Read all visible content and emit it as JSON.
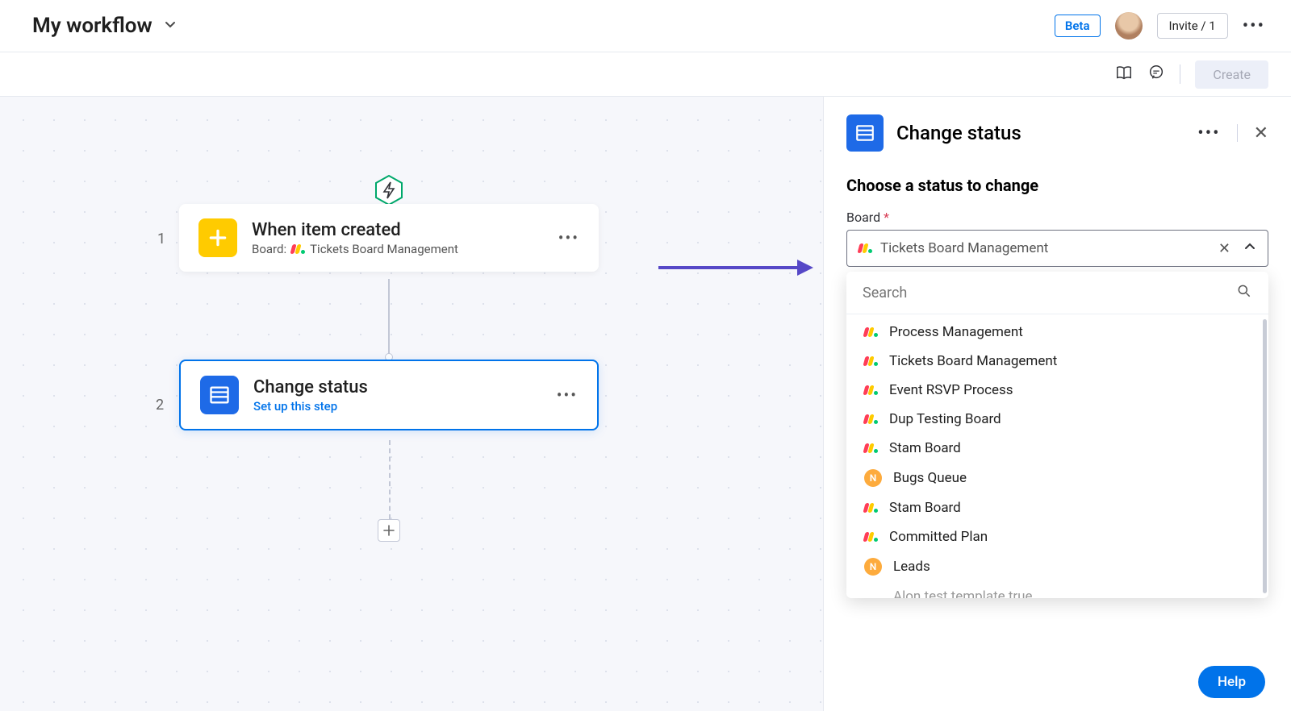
{
  "header": {
    "title": "My workflow",
    "beta_label": "Beta",
    "invite_label": "Invite / 1"
  },
  "subheader": {
    "create_label": "Create"
  },
  "canvas": {
    "steps": [
      {
        "num": "1",
        "title": "When item created",
        "sub_prefix": "Board:",
        "board": "Tickets Board Management"
      },
      {
        "num": "2",
        "title": "Change status",
        "sub_link": "Set up this step"
      }
    ]
  },
  "panel": {
    "title": "Change status",
    "section_title": "Choose a status to change",
    "board_label": "Board",
    "board_value": "Tickets Board Management",
    "search_placeholder": "Search",
    "options": [
      {
        "type": "board",
        "label": "Process Management"
      },
      {
        "type": "board",
        "label": "Tickets Board Management"
      },
      {
        "type": "board",
        "label": "Event RSVP Process"
      },
      {
        "type": "board",
        "label": "Dup Testing Board"
      },
      {
        "type": "board",
        "label": "Stam Board"
      },
      {
        "type": "letter",
        "letter": "N",
        "label": "Bugs Queue"
      },
      {
        "type": "board",
        "label": "Stam Board"
      },
      {
        "type": "board",
        "label": "Committed Plan"
      },
      {
        "type": "letter",
        "letter": "N",
        "label": "Leads"
      }
    ],
    "partial_option": "Alon test template true"
  },
  "help_label": "Help"
}
